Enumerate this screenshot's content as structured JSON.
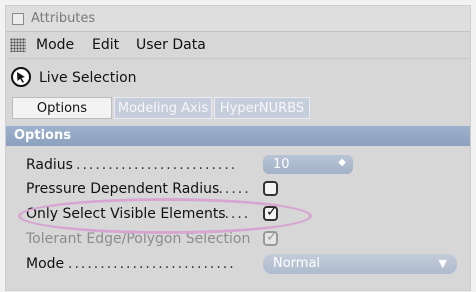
{
  "window": {
    "title": "Attributes"
  },
  "menu": {
    "items": [
      "Mode",
      "Edit",
      "User Data"
    ]
  },
  "tool": {
    "label": "Live Selection",
    "icon": "live-selection-icon"
  },
  "tabs": [
    {
      "label": "Options",
      "active": true
    },
    {
      "label": "Modeling Axis",
      "active": false
    },
    {
      "label": "HyperNURBS",
      "active": false
    }
  ],
  "section": {
    "title": "Options"
  },
  "fields": {
    "radius": {
      "label": "Radius",
      "value": "10"
    },
    "pressure": {
      "label": "Pressure Dependent Radius",
      "checked": false
    },
    "only_visible": {
      "label": "Only Select Visible Elements",
      "checked": true
    },
    "tolerant": {
      "label": "Tolerant Edge/Polygon Selection",
      "checked": true,
      "disabled": true
    },
    "mode": {
      "label": "Mode",
      "value": "Normal"
    }
  },
  "colors": {
    "section_header": "#95a9c6",
    "highlight_ellipse": "#d7a5d2"
  }
}
